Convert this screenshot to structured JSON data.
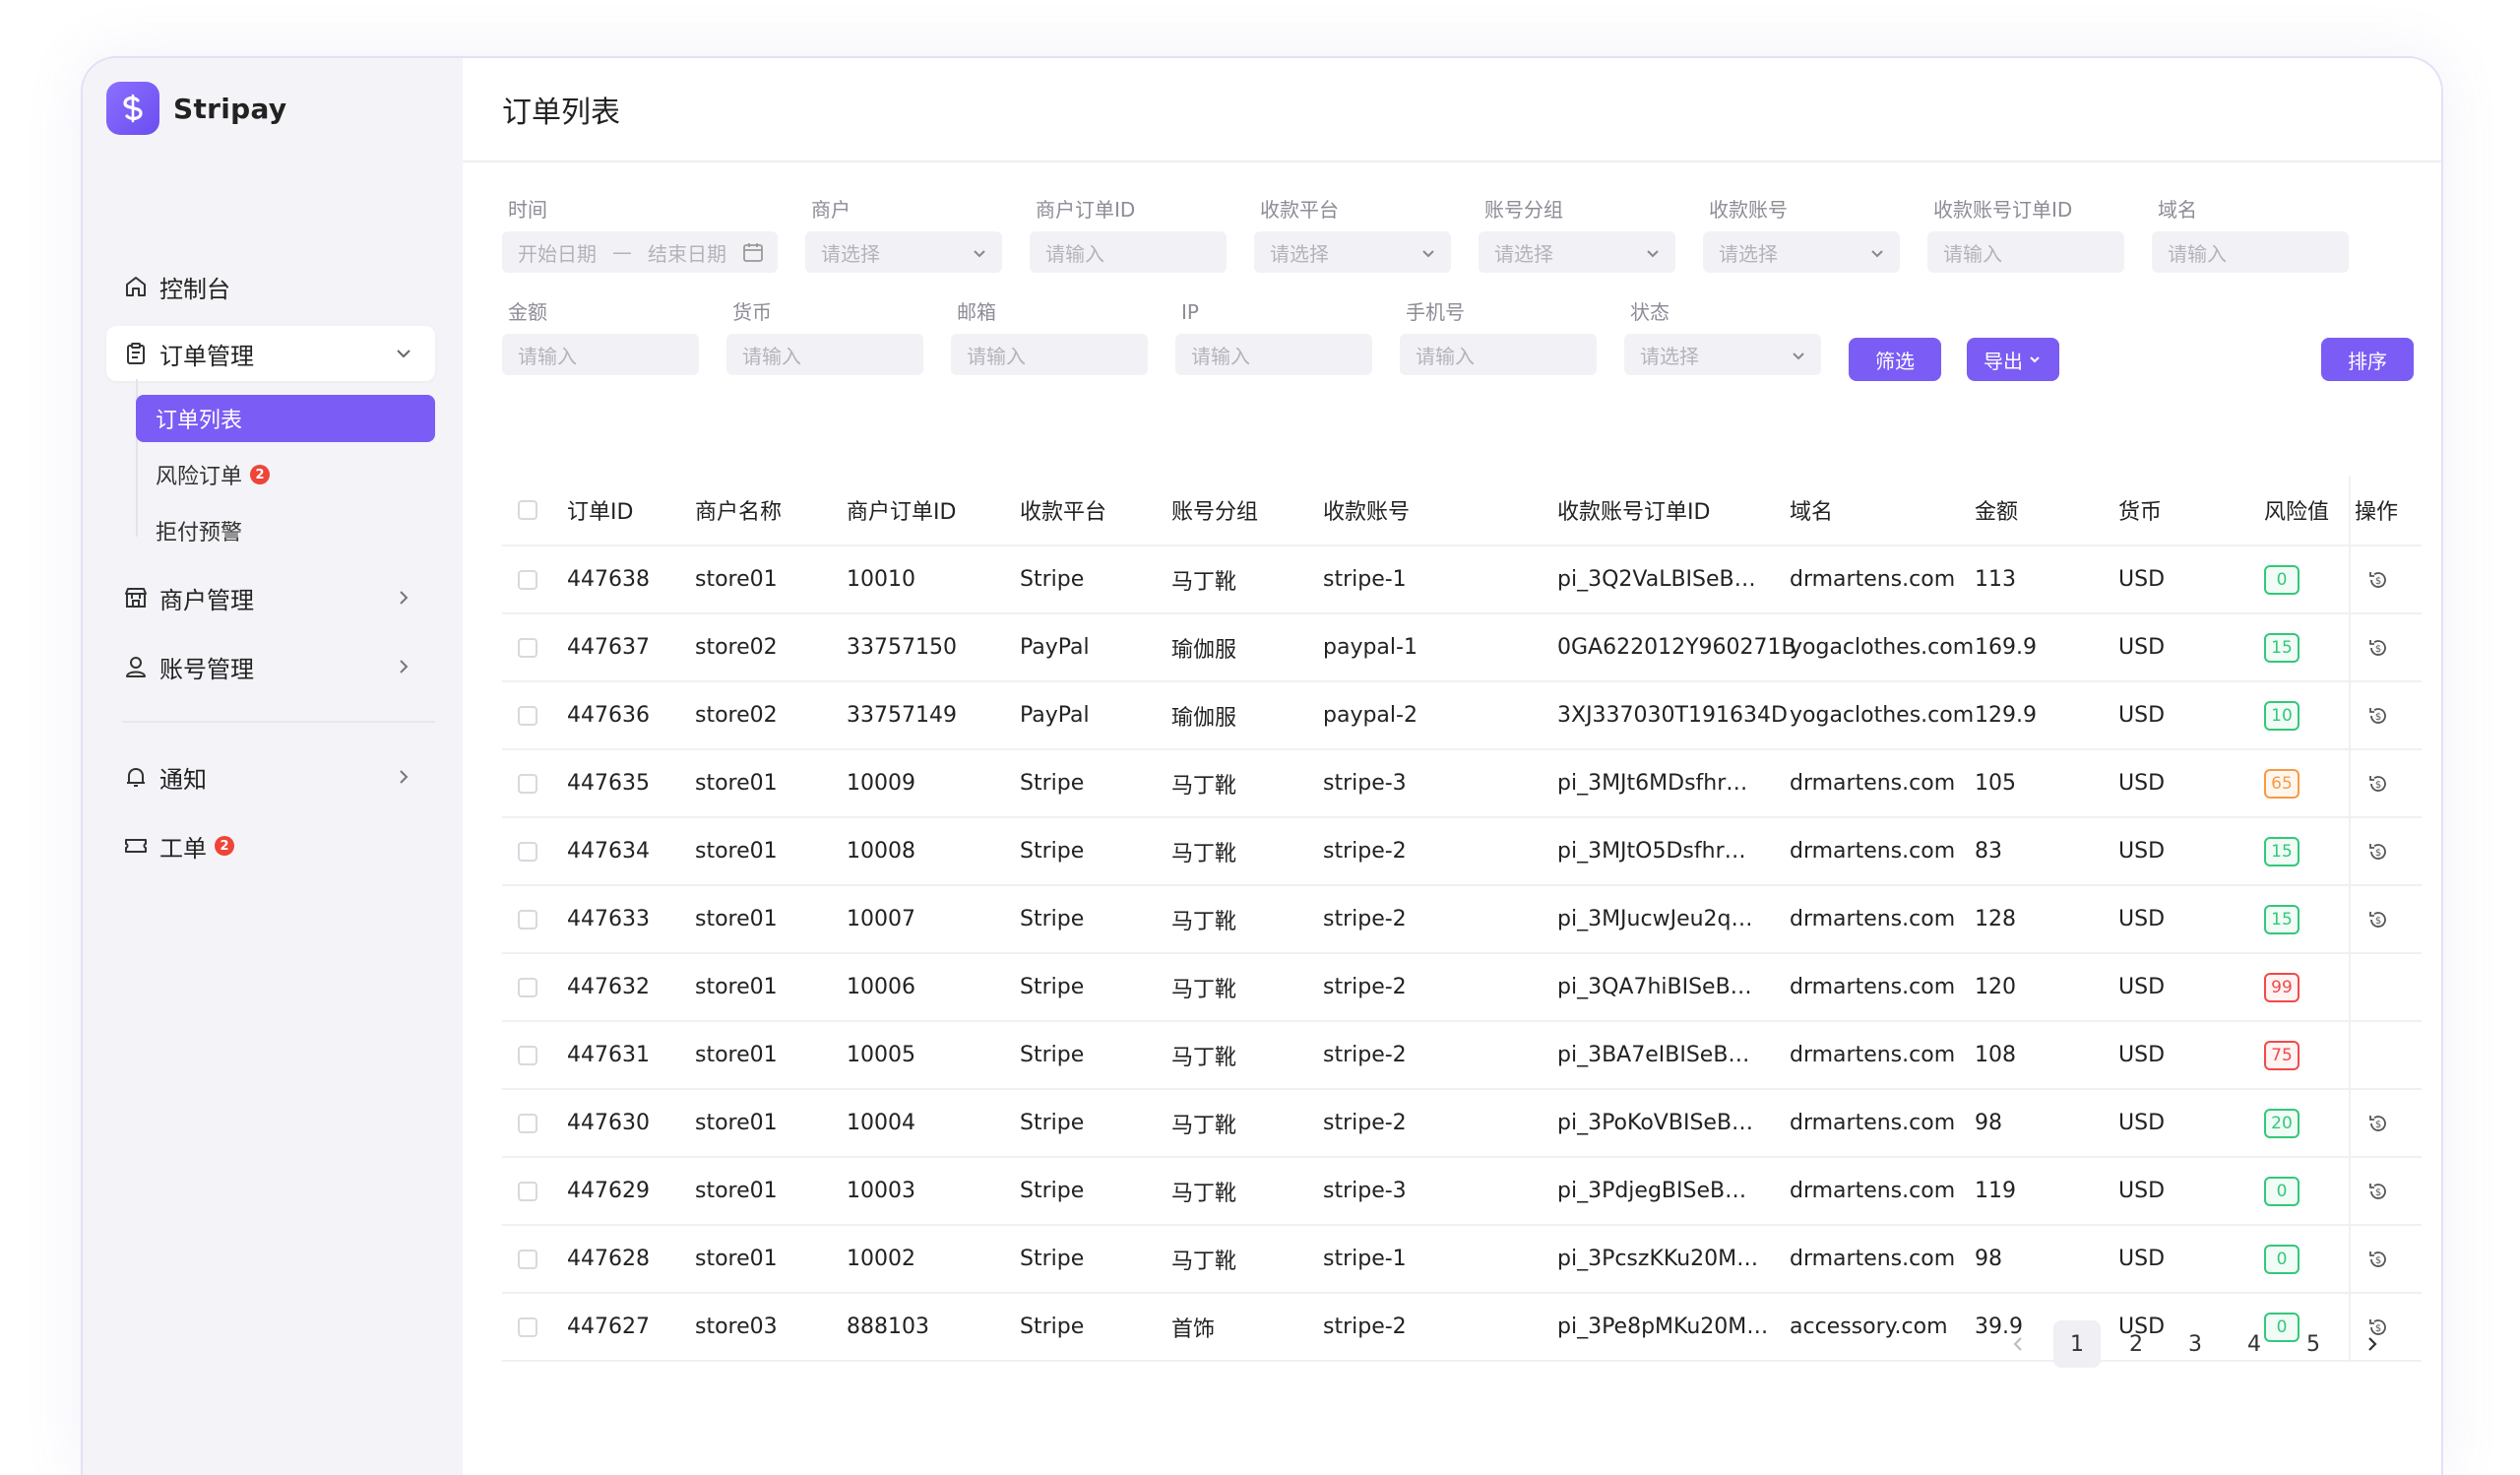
{
  "brand": {
    "name": "Stripay"
  },
  "sidebar": {
    "dashboard": "控制台",
    "orders": {
      "label": "订单管理",
      "sub": [
        {
          "label": "订单列表",
          "active": true
        },
        {
          "label": "风险订单",
          "badge": "2"
        },
        {
          "label": "拒付预警"
        }
      ]
    },
    "merchants": "商户管理",
    "accounts": "账号管理",
    "notify": "通知",
    "tickets": {
      "label": "工单",
      "badge": "2"
    }
  },
  "page": {
    "title": "订单列表"
  },
  "filters": {
    "time": {
      "label": "时间",
      "start": "开始日期",
      "sep": "—",
      "end": "结束日期"
    },
    "merchant": {
      "label": "商户",
      "placeholder": "请选择"
    },
    "merchant_order_id": {
      "label": "商户订单ID",
      "placeholder": "请输入"
    },
    "platform": {
      "label": "收款平台",
      "placeholder": "请选择"
    },
    "account_group": {
      "label": "账号分组",
      "placeholder": "请选择"
    },
    "account": {
      "label": "收款账号",
      "placeholder": "请选择"
    },
    "account_order_id": {
      "label": "收款账号订单ID",
      "placeholder": "请输入"
    },
    "domain": {
      "label": "域名",
      "placeholder": "请输入"
    },
    "amount": {
      "label": "金额",
      "placeholder": "请输入"
    },
    "currency": {
      "label": "货币",
      "placeholder": "请输入"
    },
    "email": {
      "label": "邮箱",
      "placeholder": "请输入"
    },
    "ip": {
      "label": "IP",
      "placeholder": "请输入"
    },
    "phone": {
      "label": "手机号",
      "placeholder": "请输入"
    },
    "status": {
      "label": "状态",
      "placeholder": "请选择"
    },
    "filter_btn": "筛选",
    "export_btn": "导出",
    "sort_btn": "排序"
  },
  "table": {
    "headers": [
      "订单ID",
      "商户名称",
      "商户订单ID",
      "收款平台",
      "账号分组",
      "收款账号",
      "收款账号订单ID",
      "域名",
      "金额",
      "货币",
      "风险值",
      "操作"
    ],
    "rows": [
      {
        "id": "447638",
        "store": "store01",
        "moid": "10010",
        "platform": "Stripe",
        "group": "马丁靴",
        "account": "stripe-1",
        "aoid": "pi_3Q2VaLBISeB…",
        "domain": "drmartens.com",
        "amount": "113",
        "currency": "USD",
        "risk": "0",
        "level": "green",
        "op": true
      },
      {
        "id": "447637",
        "store": "store02",
        "moid": "33757150",
        "platform": "PayPal",
        "group": "瑜伽服",
        "account": "paypal-1",
        "aoid": "0GA622012Y960271B",
        "domain": "yogaclothes.com",
        "amount": "169.9",
        "currency": "USD",
        "risk": "15",
        "level": "green",
        "op": true
      },
      {
        "id": "447636",
        "store": "store02",
        "moid": "33757149",
        "platform": "PayPal",
        "group": "瑜伽服",
        "account": "paypal-2",
        "aoid": "3XJ337030T191634D",
        "domain": "yogaclothes.com",
        "amount": "129.9",
        "currency": "USD",
        "risk": "10",
        "level": "green",
        "op": true
      },
      {
        "id": "447635",
        "store": "store01",
        "moid": "10009",
        "platform": "Stripe",
        "group": "马丁靴",
        "account": "stripe-3",
        "aoid": "pi_3MJt6MDsfhr…",
        "domain": "drmartens.com",
        "amount": "105",
        "currency": "USD",
        "risk": "65",
        "level": "orange",
        "op": true
      },
      {
        "id": "447634",
        "store": "store01",
        "moid": "10008",
        "platform": "Stripe",
        "group": "马丁靴",
        "account": "stripe-2",
        "aoid": "pi_3MJtO5Dsfhr…",
        "domain": "drmartens.com",
        "amount": "83",
        "currency": "USD",
        "risk": "15",
        "level": "green",
        "op": true
      },
      {
        "id": "447633",
        "store": "store01",
        "moid": "10007",
        "platform": "Stripe",
        "group": "马丁靴",
        "account": "stripe-2",
        "aoid": "pi_3MJucwJeu2q…",
        "domain": "drmartens.com",
        "amount": "128",
        "currency": "USD",
        "risk": "15",
        "level": "green",
        "op": true
      },
      {
        "id": "447632",
        "store": "store01",
        "moid": "10006",
        "platform": "Stripe",
        "group": "马丁靴",
        "account": "stripe-2",
        "aoid": "pi_3QA7hiBISeB…",
        "domain": "drmartens.com",
        "amount": "120",
        "currency": "USD",
        "risk": "99",
        "level": "red",
        "op": false
      },
      {
        "id": "447631",
        "store": "store01",
        "moid": "10005",
        "platform": "Stripe",
        "group": "马丁靴",
        "account": "stripe-2",
        "aoid": "pi_3BA7eIBISeB…",
        "domain": "drmartens.com",
        "amount": "108",
        "currency": "USD",
        "risk": "75",
        "level": "red",
        "op": false
      },
      {
        "id": "447630",
        "store": "store01",
        "moid": "10004",
        "platform": "Stripe",
        "group": "马丁靴",
        "account": "stripe-2",
        "aoid": "pi_3PoKoVBISeB…",
        "domain": "drmartens.com",
        "amount": "98",
        "currency": "USD",
        "risk": "20",
        "level": "green",
        "op": true
      },
      {
        "id": "447629",
        "store": "store01",
        "moid": "10003",
        "platform": "Stripe",
        "group": "马丁靴",
        "account": "stripe-3",
        "aoid": "pi_3PdjegBISeB…",
        "domain": "drmartens.com",
        "amount": "119",
        "currency": "USD",
        "risk": "0",
        "level": "green",
        "op": true
      },
      {
        "id": "447628",
        "store": "store01",
        "moid": "10002",
        "platform": "Stripe",
        "group": "马丁靴",
        "account": "stripe-1",
        "aoid": "pi_3PcszKKu20M…",
        "domain": "drmartens.com",
        "amount": "98",
        "currency": "USD",
        "risk": "0",
        "level": "green",
        "op": true
      },
      {
        "id": "447627",
        "store": "store03",
        "moid": "888103",
        "platform": "Stripe",
        "group": "首饰",
        "account": "stripe-2",
        "aoid": "pi_3Pe8pMKu20M…",
        "domain": "accessory.com",
        "amount": "39.9",
        "currency": "USD",
        "risk": "0",
        "level": "green",
        "op": true
      }
    ]
  },
  "pagination": {
    "pages": [
      "1",
      "2",
      "3",
      "4",
      "5"
    ],
    "current": "1"
  },
  "colors": {
    "accent": "#7b5cf5",
    "risk_green": "#34c77b",
    "risk_orange": "#f79a45",
    "risk_red": "#f04a4a"
  }
}
